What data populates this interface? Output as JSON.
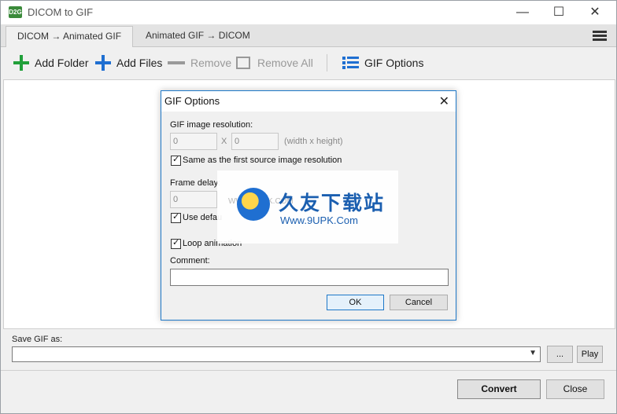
{
  "window": {
    "title": "DICOM to GIF",
    "icon_text": "D2G",
    "controls": {
      "minimize": "—",
      "maximize": "☐",
      "close": "✕"
    }
  },
  "tabs": [
    {
      "label": "DICOM → Animated GIF",
      "active": true
    },
    {
      "label": "Animated GIF → DICOM",
      "active": false
    }
  ],
  "toolbar": {
    "add_folder": "Add Folder",
    "add_files": "Add Files",
    "remove": "Remove",
    "remove_all": "Remove All",
    "gif_options": "GIF Options",
    "colors": {
      "green": "#21a03a",
      "blue": "#1f6fd1"
    }
  },
  "bottom": {
    "save_label": "Save GIF as:",
    "save_value": "",
    "browse_label": "...",
    "play_label": "Play",
    "convert_label": "Convert",
    "close_label": "Close"
  },
  "dialog": {
    "title": "GIF Options",
    "resolution_label": "GIF image resolution:",
    "width_value": "0",
    "x_label": "X",
    "height_value": "0",
    "resolution_hint": "(width x height)",
    "same_resolution_label": "Same as the first source image resolution",
    "same_resolution_checked": true,
    "frame_delay_label": "Frame delay:",
    "frame_delay_value": "0",
    "use_default_label": "Use defau",
    "use_default_checked": true,
    "loop_label": "Loop animation",
    "loop_checked": true,
    "comment_label": "Comment:",
    "comment_value": "",
    "ok_label": "OK",
    "cancel_label": "Cancel"
  },
  "watermark": {
    "main": "久友下载站",
    "sub": "Www.9UPK.Com",
    "faint": "WWW.9UPK.COM"
  }
}
